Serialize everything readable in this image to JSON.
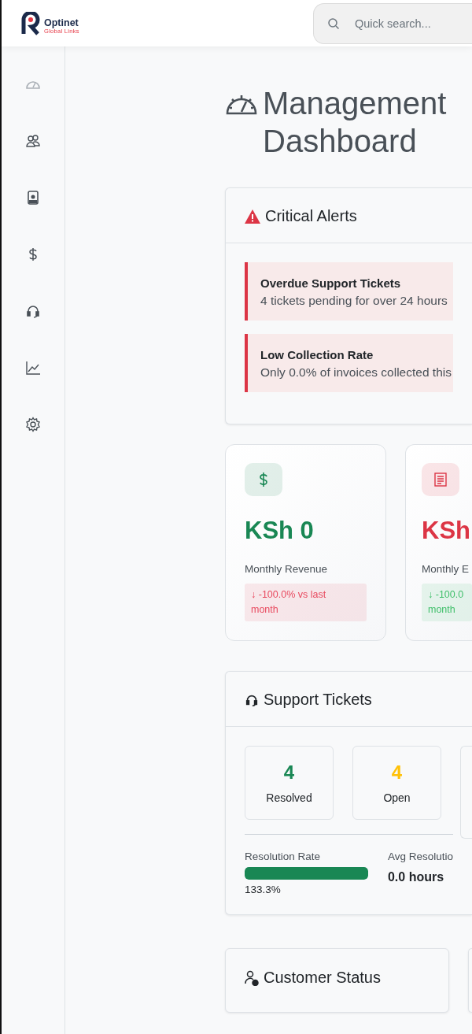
{
  "header": {
    "logo": {
      "name": "Optinet",
      "tagline": "Global Links"
    },
    "search": {
      "placeholder": "Quick search..."
    }
  },
  "sidebar": {
    "items": [
      {
        "kind": "dashboard",
        "selected": true
      },
      {
        "kind": "users",
        "selected": false
      },
      {
        "kind": "contact",
        "selected": false
      },
      {
        "kind": "dollar",
        "selected": false
      },
      {
        "kind": "headset",
        "selected": false
      },
      {
        "kind": "chart",
        "selected": false
      },
      {
        "kind": "settings",
        "selected": false
      }
    ]
  },
  "page": {
    "title": "Management Dashboard"
  },
  "alerts": {
    "title": "Critical Alerts",
    "items": [
      {
        "title": "Overdue Support Tickets",
        "text": "4 tickets pending for over 24 hours"
      },
      {
        "title": "Low Collection Rate",
        "text": "Only 0.0% of invoices collected this"
      }
    ]
  },
  "stats": [
    {
      "kind": "dollar",
      "color": "#198754",
      "value": "KSh 0",
      "label": "Monthly Revenue",
      "change": {
        "color": "#e84a5f",
        "lines": [
          "↓ -100.0% vs last",
          "month"
        ]
      }
    },
    {
      "kind": "receipt",
      "color": "#dc3545",
      "value": "KSh",
      "label": "Monthly E",
      "change": {
        "color": "#3fbf6a",
        "lines": [
          "↓ -100.0",
          "month"
        ]
      }
    }
  ],
  "tickets": {
    "title": "Support Tickets",
    "counts": [
      {
        "value": "4",
        "label": "Resolved",
        "color": "#198754"
      },
      {
        "value": "4",
        "label": "Open",
        "color": "#ffc107"
      }
    ],
    "resolution": {
      "label": "Resolution Rate",
      "level": 1,
      "reading": "133.3%"
    },
    "avg": {
      "label": "Avg Resolutio",
      "value": "0.0 hours"
    }
  },
  "customers": {
    "title": "Customer Status"
  }
}
